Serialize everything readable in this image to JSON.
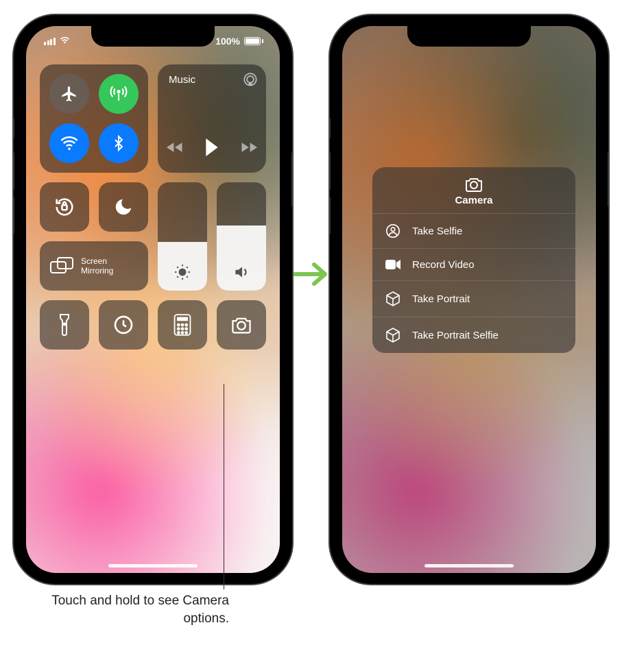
{
  "status": {
    "battery_text": "100%",
    "signal_bars": 4,
    "wifi_on": true
  },
  "control_center": {
    "connectivity": {
      "airplane_on": false,
      "cellular_on": true,
      "wifi_on": true,
      "bluetooth_on": true
    },
    "now_playing": {
      "title": "Music"
    },
    "screen_mirroring_label": "Screen\nMirroring",
    "brightness_percent": 45,
    "volume_percent": 60
  },
  "camera_menu": {
    "title": "Camera",
    "items": [
      {
        "icon": "person-circle-icon",
        "label": "Take Selfie"
      },
      {
        "icon": "video-icon",
        "label": "Record Video"
      },
      {
        "icon": "cube-icon",
        "label": "Take Portrait"
      },
      {
        "icon": "cube-icon",
        "label": "Take Portrait Selfie"
      }
    ]
  },
  "caption": "Touch and hold to see Camera options.",
  "colors": {
    "green": "#35c759",
    "blue": "#0a7aff",
    "arrow": "#7bc650"
  }
}
